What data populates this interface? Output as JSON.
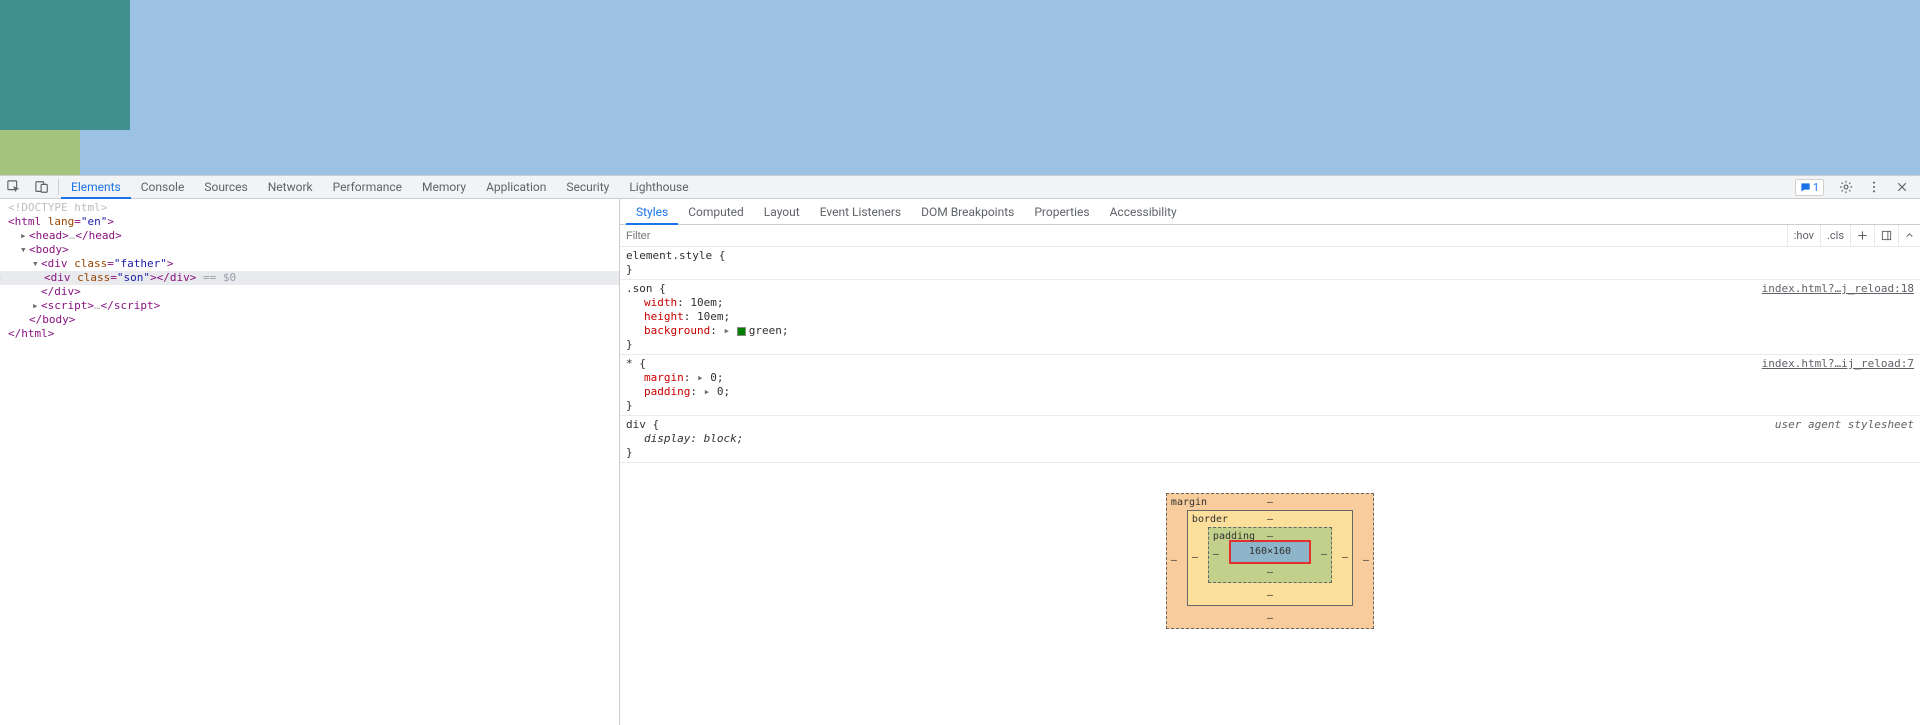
{
  "devtools_tabs": [
    "Elements",
    "Console",
    "Sources",
    "Network",
    "Performance",
    "Memory",
    "Application",
    "Security",
    "Lighthouse"
  ],
  "devtools_active_tab": 0,
  "issues_count": "1",
  "elements_tree": {
    "doctype": "<!DOCTYPE html>",
    "html_open": "html",
    "html_lang_attr": "lang",
    "html_lang_val": "\"en\"",
    "head_open": "head",
    "head_ellipsis": "…",
    "head_close": "head",
    "body_open": "body",
    "div_tag": "div",
    "father_class_attr": "class",
    "father_class_val": "\"father\"",
    "son_class_attr": "class",
    "son_class_val": "\"son\"",
    "div_close": "div",
    "sel_annotation": " == $0",
    "script_open": "script",
    "script_ellipsis": "…",
    "script_close": "script",
    "body_close": "body",
    "html_close": "html"
  },
  "styles_tabs": [
    "Styles",
    "Computed",
    "Layout",
    "Event Listeners",
    "DOM Breakpoints",
    "Properties",
    "Accessibility"
  ],
  "styles_active_tab": 0,
  "filter_placeholder": "Filter",
  "filter_controls": {
    "hov": ":hov",
    "cls": ".cls"
  },
  "rules": {
    "element_style": {
      "selector": "element.style",
      "open": " {",
      "close": "}"
    },
    "son": {
      "selector": ".son",
      "open": " {",
      "origin": "index.html?…j_reload:18",
      "d1_prop": "width",
      "d1_val": "10em",
      "d2_prop": "height",
      "d2_val": "10em",
      "d3_prop": "background",
      "d3_val": "green",
      "d3_swatch": "#008000",
      "close": "}"
    },
    "star": {
      "selector": "*",
      "open": " {",
      "origin": "index.html?…ij_reload:7",
      "d1_prop": "margin",
      "d1_val": "0",
      "d2_prop": "padding",
      "d2_val": "0",
      "close": "}"
    },
    "div": {
      "selector": "div",
      "open": " {",
      "origin": "user agent stylesheet",
      "d1_prop": "display",
      "d1_val": "block",
      "close": "}"
    }
  },
  "box_model": {
    "margin_label": "margin",
    "border_label": "border",
    "padding_label": "padding",
    "dash": "–",
    "content": "160×160"
  }
}
